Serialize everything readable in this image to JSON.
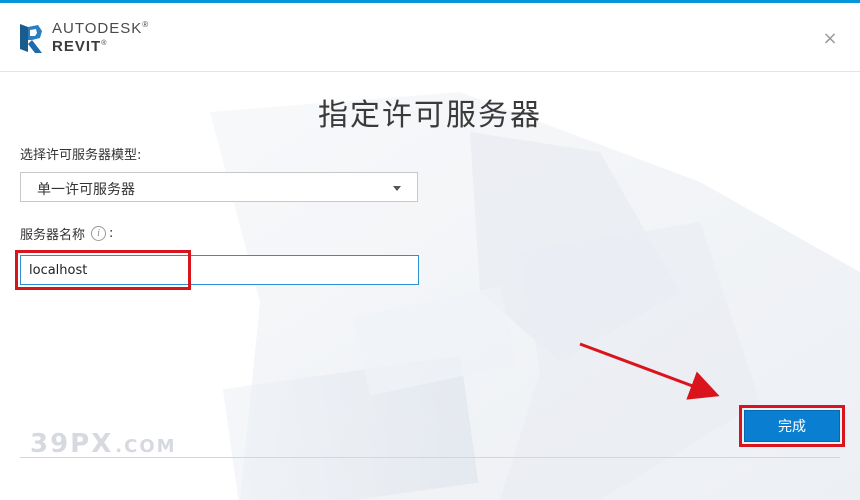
{
  "window": {
    "brand_top": "AUTODESK",
    "brand_trademark": "®",
    "brand_bottom": "REVIT",
    "close_symbol": "×",
    "accent_color": "#0696d7"
  },
  "dialog": {
    "title": "指定许可服务器",
    "model_label": "选择许可服务器模型:",
    "model_selected": "单一许可服务器",
    "server_name_label": "服务器名称",
    "server_name_colon": ":",
    "info_icon_glyph": "i",
    "server_name_value": "localhost",
    "finish_label": "完成"
  },
  "watermark": {
    "main": "39PX",
    "sub": ".COM"
  },
  "annotations": {
    "highlight_color": "#d9141c"
  },
  "icons": {
    "logo": "revit-r-logo",
    "close": "close-icon",
    "dropdown": "chevron-down-icon",
    "info": "info-icon"
  }
}
